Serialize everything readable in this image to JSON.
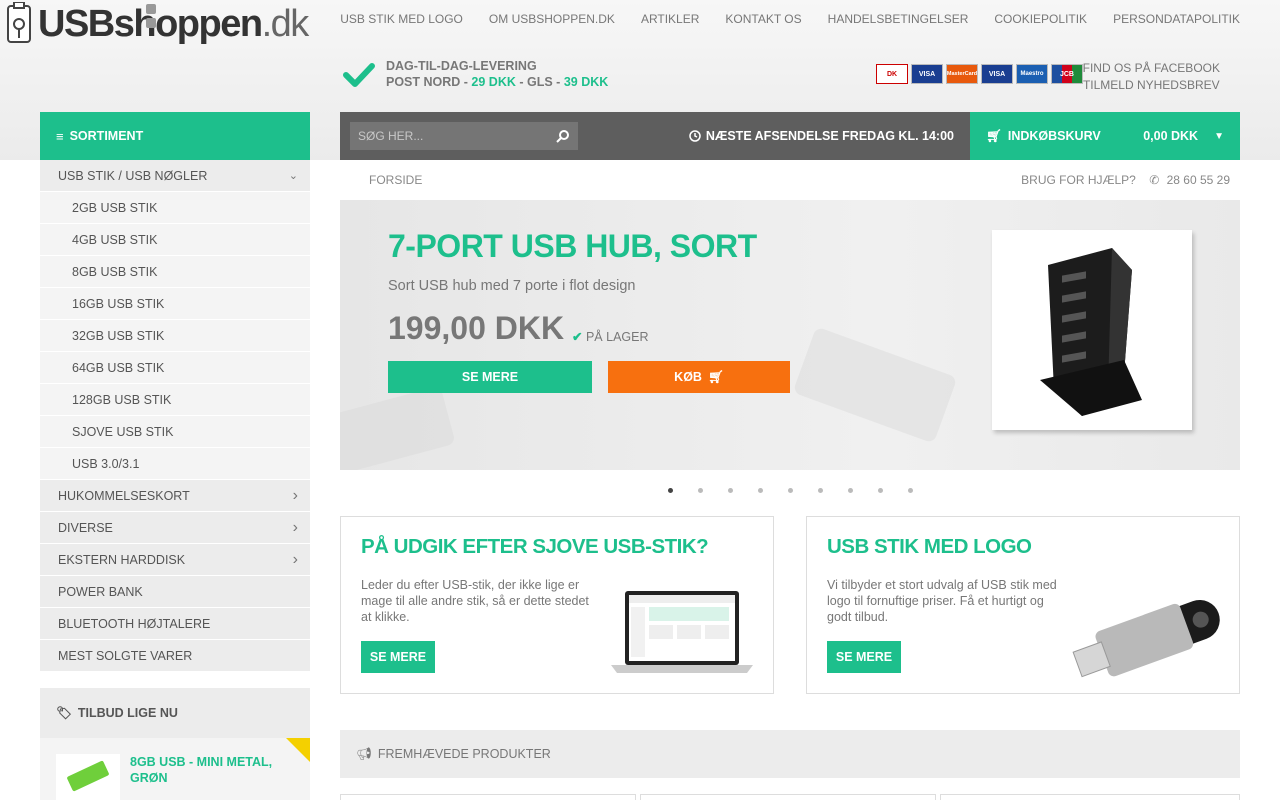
{
  "header": {
    "logo_main": "USBshoppen",
    "logo_suffix": ".dk",
    "nav": [
      "USB STIK MED LOGO",
      "OM USBSHOPPEN.DK",
      "ARTIKLER",
      "KONTAKT OS",
      "HANDELSBETINGELSER",
      "COOKIEPOLITIK",
      "PERSONDATAPOLITIK"
    ],
    "delivery": {
      "line1": "DAG-TIL-DAG-LEVERING",
      "postnord_label": "POST NORD - ",
      "postnord_price": "29 DKK",
      "gls_label": " - GLS - ",
      "gls_price": "39 DKK"
    },
    "cards": [
      "DK",
      "VISA",
      "MasterCard",
      "VISA",
      "Maestro",
      "JCB"
    ],
    "facebook_link": "FIND OS PÅ FACEBOOK",
    "newsletter_link": "TILMELD NYHEDSBREV"
  },
  "bar": {
    "sortiment": "SORTIMENT",
    "search_placeholder": "SØG HER...",
    "shipping": "NÆSTE AFSENDELSE FREDAG KL. 14:00",
    "cart_label": "INDKØBSKURV",
    "cart_total": "0,00 DKK"
  },
  "sidebar": {
    "items": [
      {
        "label": "USB STIK / USB NØGLER",
        "sub": false,
        "chev": "down"
      },
      {
        "label": "2GB USB STIK",
        "sub": true,
        "chev": ""
      },
      {
        "label": "4GB USB STIK",
        "sub": true,
        "chev": ""
      },
      {
        "label": "8GB USB STIK",
        "sub": true,
        "chev": ""
      },
      {
        "label": "16GB USB STIK",
        "sub": true,
        "chev": ""
      },
      {
        "label": "32GB USB STIK",
        "sub": true,
        "chev": ""
      },
      {
        "label": "64GB USB STIK",
        "sub": true,
        "chev": ""
      },
      {
        "label": "128GB USB STIK",
        "sub": true,
        "chev": ""
      },
      {
        "label": "SJOVE USB STIK",
        "sub": true,
        "chev": ""
      },
      {
        "label": "USB 3.0/3.1",
        "sub": true,
        "chev": ""
      },
      {
        "label": "HUKOMMELSESKORT",
        "sub": false,
        "chev": "right"
      },
      {
        "label": "DIVERSE",
        "sub": false,
        "chev": "right"
      },
      {
        "label": "EKSTERN HARDDISK",
        "sub": false,
        "chev": "right"
      },
      {
        "label": "POWER BANK",
        "sub": false,
        "chev": ""
      },
      {
        "label": "BLUETOOTH HØJTALERE",
        "sub": false,
        "chev": ""
      },
      {
        "label": "MEST SOLGTE VARER",
        "sub": false,
        "chev": ""
      }
    ],
    "offers_title": "TILBUD LIGE NU",
    "offer_product_line1": "8GB USB - MINI METAL,",
    "offer_product_line2": "GRØN"
  },
  "breadcrumb": {
    "home": "FORSIDE",
    "help": "BRUG FOR HJÆLP?",
    "phone": "28 60 55 29"
  },
  "hero": {
    "title": "7-PORT USB HUB, SORT",
    "subtitle": "Sort USB hub med 7 porte i flot design",
    "price": "199,00 DKK",
    "stock": "PÅ LAGER",
    "btn_more": "SE MERE",
    "btn_buy": "KØB",
    "slide_count": 9,
    "active_slide": 1
  },
  "promos": [
    {
      "title": "PÅ UDGIK EFTER SJOVE USB-STIK?",
      "text": "Leder du efter USB-stik, der ikke lige er mage til alle andre stik, så er dette stedet at klikke.",
      "button": "SE MERE"
    },
    {
      "title": "USB STIK MED LOGO",
      "text": "Vi tilbyder et stort udvalg af USB stik med logo til fornuftige priser. Få et hurtigt og godt tilbud.",
      "button": "SE MERE"
    }
  ],
  "featured": {
    "title": "FREMHÆVEDE PRODUKTER"
  },
  "colors": {
    "accent": "#1dbf8c",
    "orange": "#f7700f",
    "dark_bar": "#5e5e5e"
  }
}
